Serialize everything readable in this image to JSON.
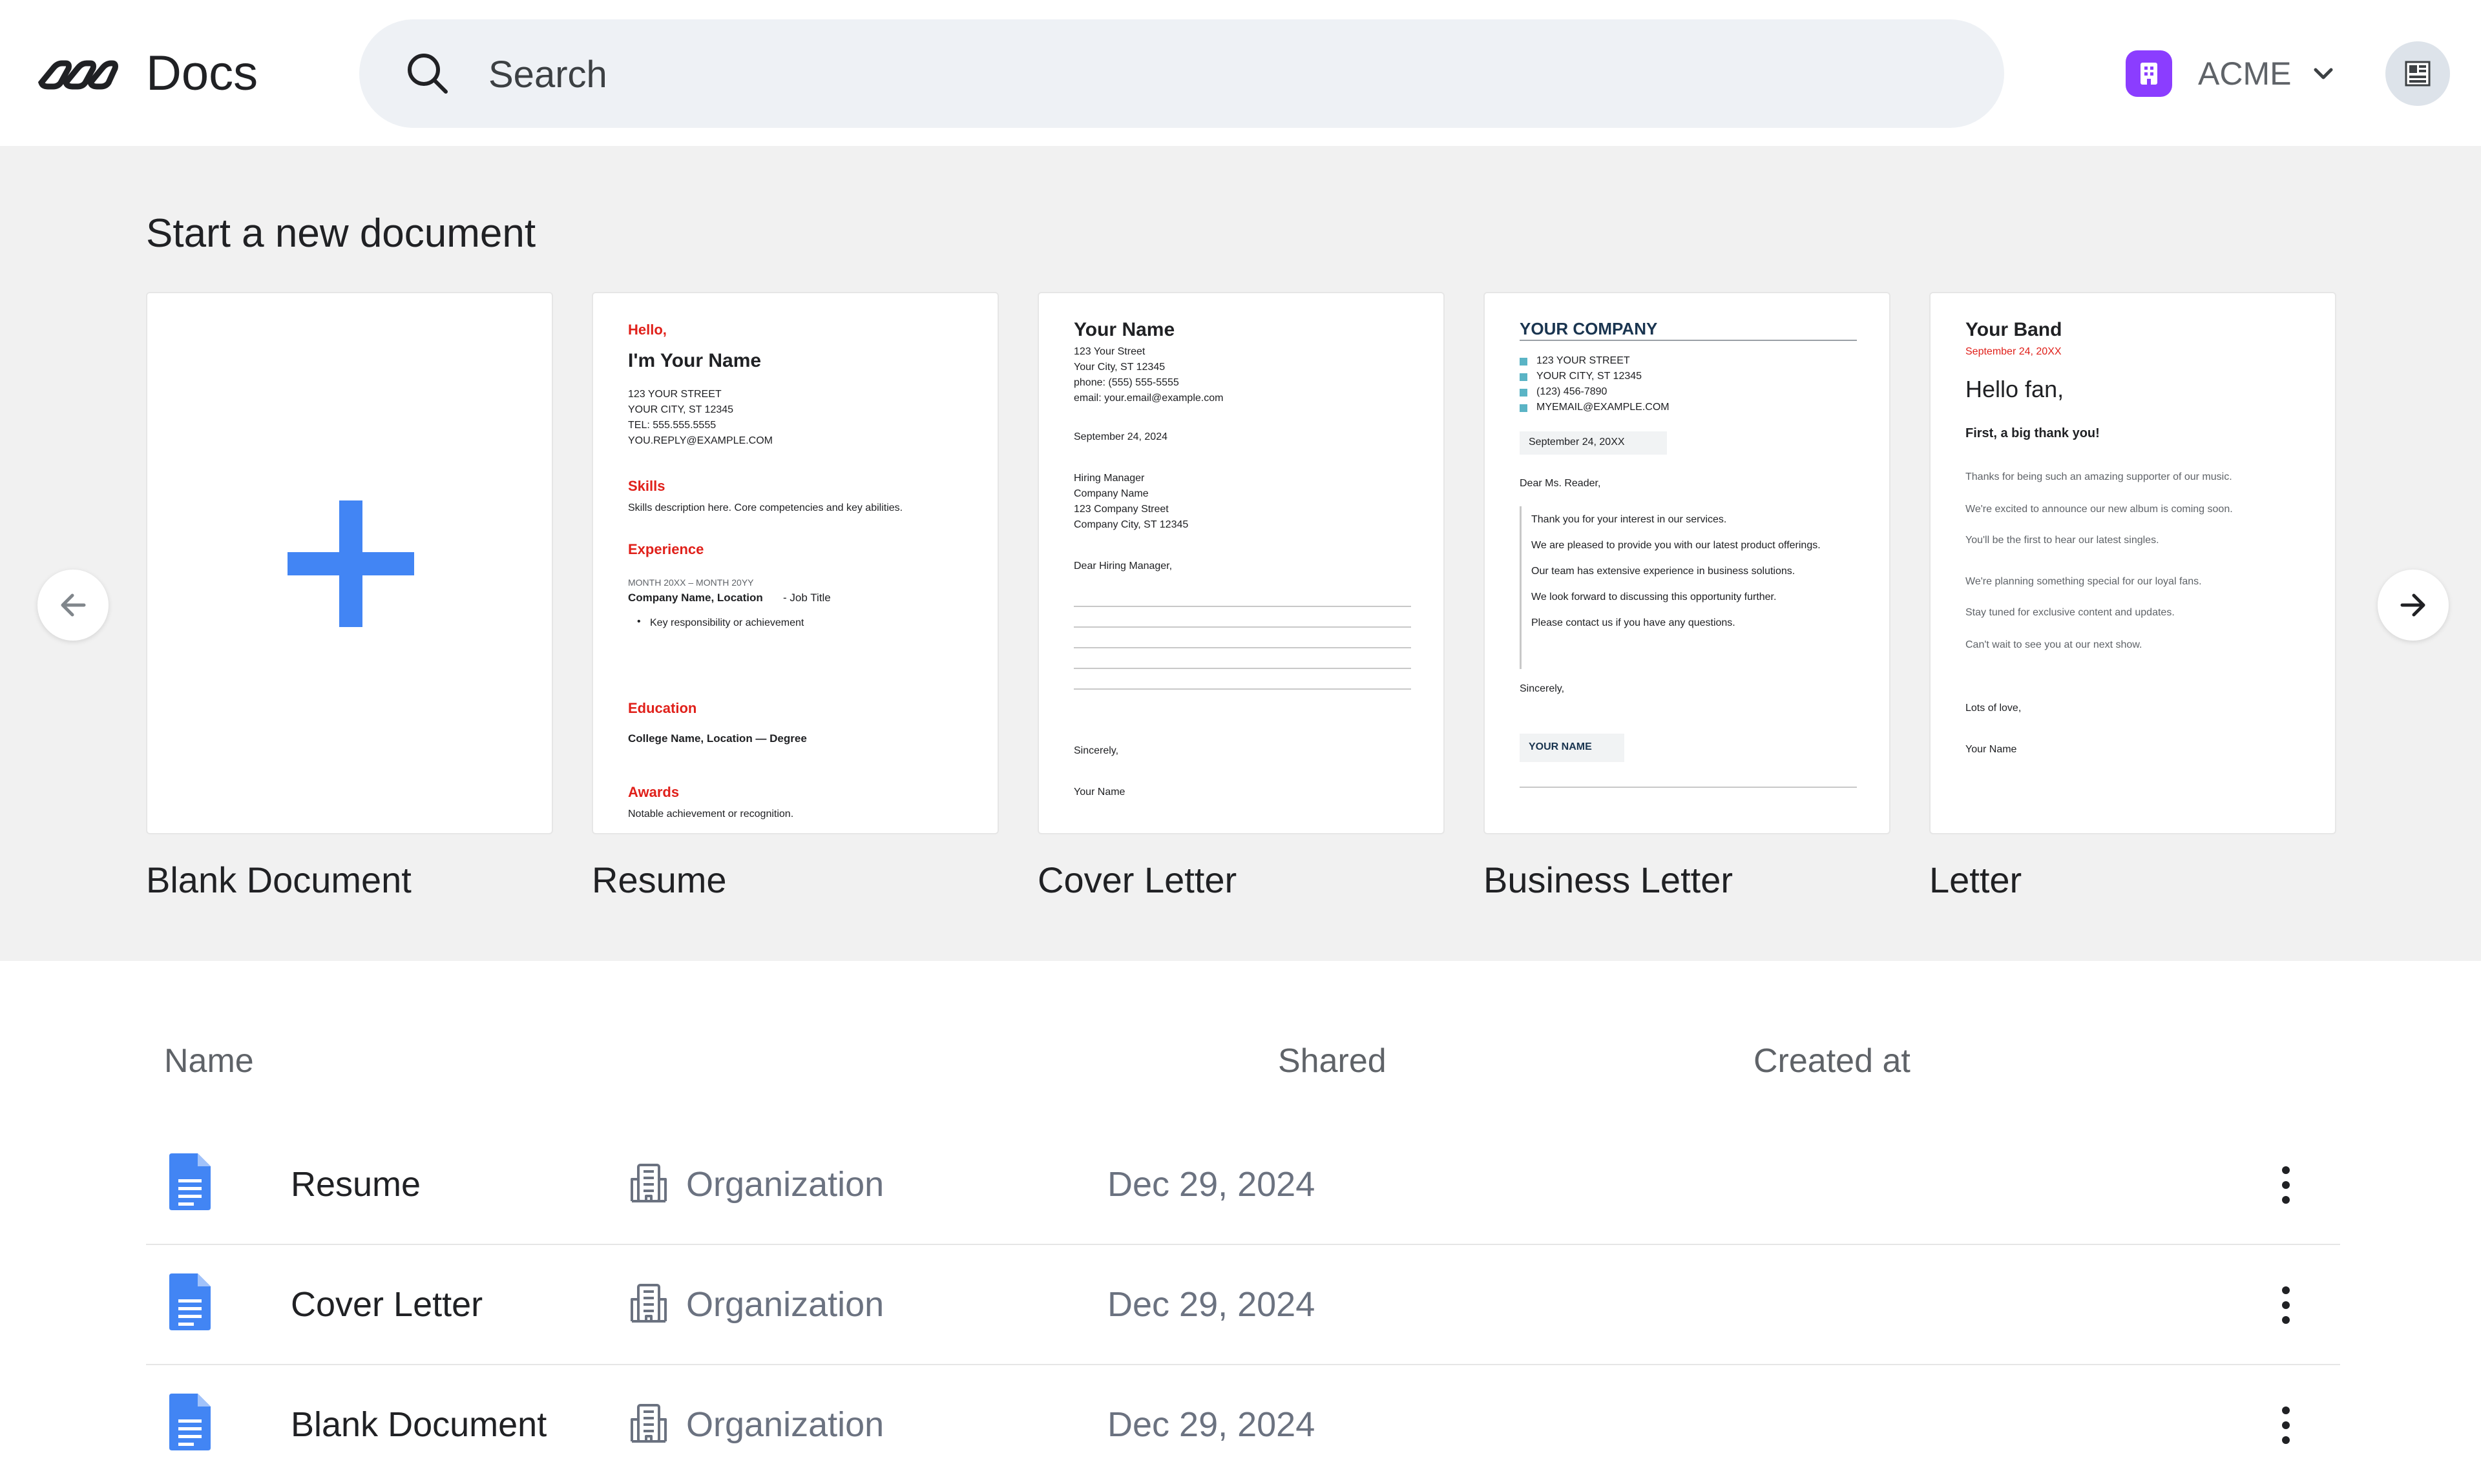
{
  "header": {
    "app_title": "Docs",
    "search_placeholder": "Search",
    "org_name": "ACME"
  },
  "templates": {
    "section_title": "Start a new document",
    "items": [
      {
        "label": "Blank Document"
      },
      {
        "label": "Resume"
      },
      {
        "label": "Cover Letter"
      },
      {
        "label": "Business Letter"
      },
      {
        "label": "Letter"
      }
    ],
    "resume_preview": {
      "greeting": "Hello,",
      "name": "I'm Your Name",
      "street": "123 YOUR STREET",
      "city": "YOUR CITY, ST 12345",
      "tel": "TEL: 555.555.5555",
      "email": "YOU.REPLY@EXAMPLE.COM",
      "skills_heading": "Skills",
      "skills_text": "Skills description here. Core competencies and key abilities.",
      "experience_heading": "Experience",
      "experience_dates": "MONTH 20XX – MONTH 20YY",
      "experience_company": "Company Name, Location",
      "experience_title": "- Job Title",
      "experience_bullet": "Key responsibility or achievement",
      "education_heading": "Education",
      "education_text": "College Name, Location — Degree",
      "awards_heading": "Awards",
      "awards_text": "Notable achievement or recognition."
    },
    "cover_preview": {
      "name": "Your Name",
      "street": "123 Your Street",
      "city": "Your City, ST 12345",
      "phone": "phone: (555) 555-5555",
      "email": "email: your.email@example.com",
      "date": "September 24, 2024",
      "to1": "Hiring Manager",
      "to2": "Company Name",
      "to3": "123 Company Street",
      "to4": "Company City, ST 12345",
      "salutation": "Dear Hiring Manager,",
      "closing": "Sincerely,",
      "signature": "Your Name"
    },
    "business_preview": {
      "company": "YOUR COMPANY",
      "street": "123 YOUR STREET",
      "city": "YOUR CITY, ST 12345",
      "phone": "(123) 456-7890",
      "email": "MYEMAIL@EXAMPLE.COM",
      "date": "September 24, 20XX",
      "salutation": "Dear Ms. Reader,",
      "p1": "Thank you for your interest in our services.",
      "p2": "We are pleased to provide you with our latest product offerings.",
      "p3": "Our team has extensive experience in business solutions.",
      "p4": "We look forward to discussing this opportunity further.",
      "p5": "Please contact us if you have any questions.",
      "closing": "Sincerely,",
      "signature": "YOUR NAME"
    },
    "letter_preview": {
      "band": "Your Band",
      "date": "September 24, 20XX",
      "greeting": "Hello fan,",
      "lead": "First, a big thank you!",
      "l1": "Thanks for being such an amazing supporter of our music.",
      "l2": "We're excited to announce our new album is coming soon.",
      "l3": "You'll be the first to hear our latest singles.",
      "l4": "We're planning something special for our loyal fans.",
      "l5": "Stay tuned for exclusive content and updates.",
      "l6": "Can't wait to see you at our next show.",
      "closing": "Lots of love,",
      "signature": "Your Name"
    }
  },
  "list": {
    "columns": {
      "name": "Name",
      "shared": "Shared",
      "created": "Created at"
    },
    "rows": [
      {
        "name": "Resume",
        "shared": "Organization",
        "created": "Dec 29, 2024"
      },
      {
        "name": "Cover Letter",
        "shared": "Organization",
        "created": "Dec 29, 2024"
      },
      {
        "name": "Blank Document",
        "shared": "Organization",
        "created": "Dec 29, 2024"
      }
    ]
  },
  "colors": {
    "accent_blue": "#4285f4",
    "org_badge": "#8b3dff",
    "template_red": "#e0201a",
    "business_teal": "#5ab4c5"
  },
  "icons": [
    "logo-icon",
    "search-icon",
    "building-icon",
    "chevron-down-icon",
    "avatar-icon",
    "plus-icon",
    "arrow-left-icon",
    "arrow-right-icon",
    "document-icon",
    "organization-icon",
    "more-vertical-icon"
  ]
}
